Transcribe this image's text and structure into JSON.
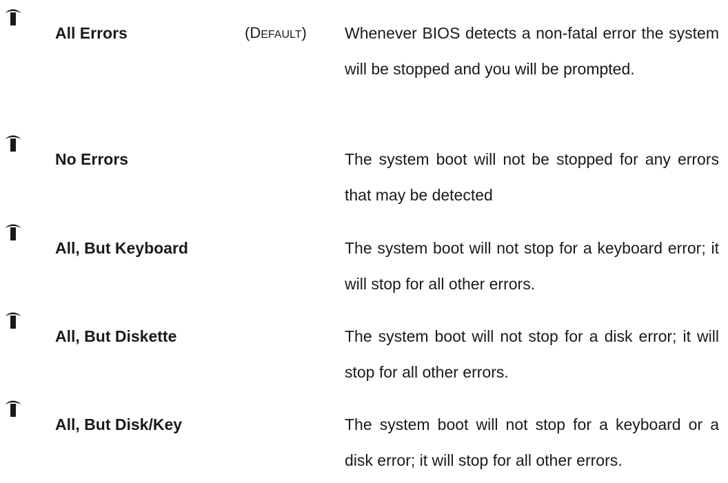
{
  "options": [
    {
      "label": "All Errors",
      "default_tag": "(DEFAULT)",
      "description": "Whenever BIOS detects a non-fatal error the system will be stopped and you will be prompted."
    },
    {
      "label": "No Errors",
      "description": "The system boot will not be stopped for any errors that may be detected"
    },
    {
      "label": "All, But Keyboard",
      "description": "The system boot will not stop for a keyboard error; it will stop for all other errors."
    },
    {
      "label": "All, But Diskette",
      "description": "The system boot will not stop for a disk error; it will stop for all other errors."
    },
    {
      "label": "All, But Disk/Key",
      "description": "The system boot will not stop for a keyboard or a disk error; it will stop for all other errors."
    }
  ],
  "icons": {
    "bullet": "arrow-up-bullet-icon"
  },
  "colors": {
    "text": "#1a1a1a",
    "background": "#ffffff"
  }
}
